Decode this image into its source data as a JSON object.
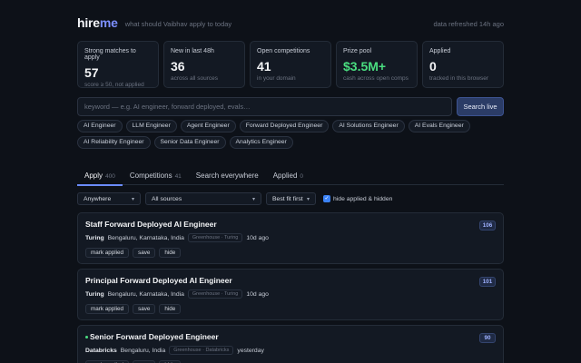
{
  "header": {
    "logo_hire": "hire",
    "logo_me": "me",
    "tagline": "what should Vaibhav apply to today",
    "refreshed": "data refreshed 14h ago"
  },
  "stats": [
    {
      "label": "Strong matches to apply",
      "value": "57",
      "sub": "score ≥ 50, not applied"
    },
    {
      "label": "New in last 48h",
      "value": "36",
      "sub": "across all sources"
    },
    {
      "label": "Open competitions",
      "value": "41",
      "sub": "in your domain"
    },
    {
      "label": "Prize pool",
      "value": "$3.5M+",
      "sub": "cash across open comps"
    },
    {
      "label": "Applied",
      "value": "0",
      "sub": "tracked in this browser"
    }
  ],
  "search": {
    "placeholder": "keyword — e.g. AI engineer, forward deployed, evals…",
    "value": "",
    "button_label": "Search live"
  },
  "chips": [
    "AI Engineer",
    "LLM Engineer",
    "Agent Engineer",
    "Forward Deployed Engineer",
    "AI Solutions Engineer",
    "AI Evals Engineer",
    "AI Reliability Engineer",
    "Senior Data Engineer",
    "Analytics Engineer"
  ],
  "tabs": [
    {
      "label": "Apply",
      "count": "400"
    },
    {
      "label": "Competitions",
      "count": "41"
    },
    {
      "label": "Search everywhere",
      "count": ""
    },
    {
      "label": "Applied",
      "count": "0"
    }
  ],
  "filters": {
    "location": "Anywhere",
    "source": "All sources",
    "sort": "Best fit first",
    "hide_label": "hide applied & hidden"
  },
  "jobs": [
    {
      "title": "Staff Forward Deployed AI Engineer",
      "company": "Turing",
      "location": "Bengaluru, Karnataka, India",
      "source": "Greenhouse · Turing",
      "age": "10d ago",
      "score": "106",
      "new": false
    },
    {
      "title": "Principal Forward Deployed AI Engineer",
      "company": "Turing",
      "location": "Bengaluru, Karnataka, India",
      "source": "Greenhouse · Turing",
      "age": "10d ago",
      "score": "101",
      "new": false
    },
    {
      "title": "Senior Forward Deployed Engineer",
      "company": "Databricks",
      "location": "Bengaluru, India",
      "source": "Greenhouse · Databricks",
      "age": "yesterday",
      "score": "90",
      "new": true
    }
  ],
  "job_actions": {
    "mark_applied": "mark applied",
    "save": "save",
    "hide": "hide"
  },
  "colors": {
    "accent": "#6b8cff",
    "green": "#4ade80",
    "background": "#0d1118"
  }
}
